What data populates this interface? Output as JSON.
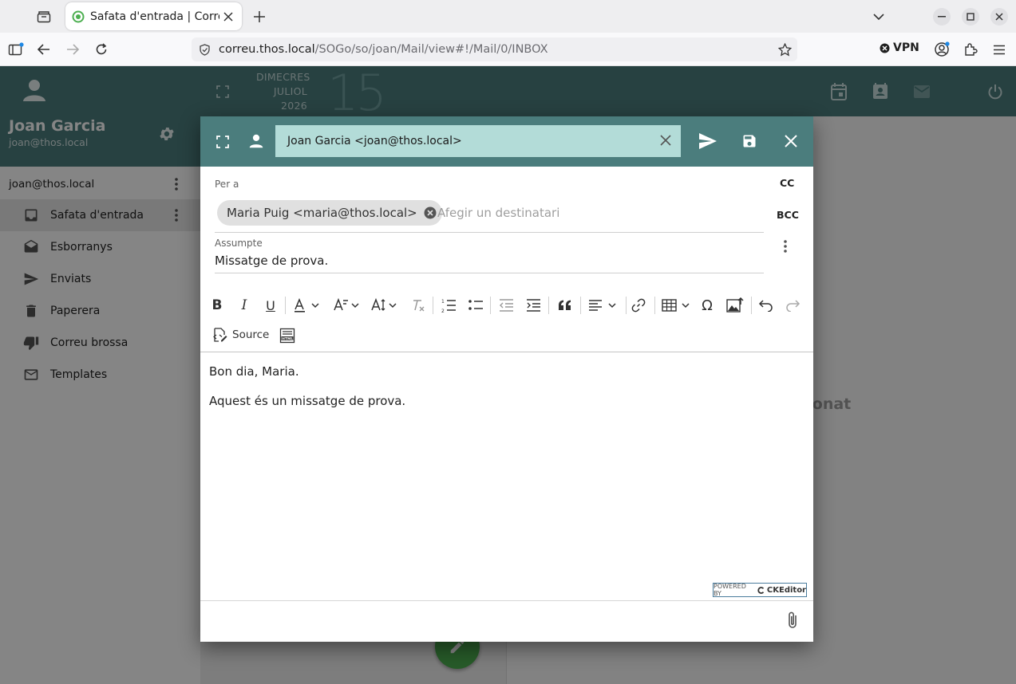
{
  "browser": {
    "tab_title": "Safata d'entrada | Correu",
    "url_host": "correu.thos.local",
    "url_path": "/SOGo/so/joan/Mail/view#!/Mail/0/INBOX",
    "vpn_label": "VPN"
  },
  "user": {
    "name": "Joan Garcia",
    "email": "joan@thos.local"
  },
  "account": "joan@thos.local",
  "folders": [
    {
      "label": "Safata d'entrada",
      "icon": "inbox-icon"
    },
    {
      "label": "Esborranys",
      "icon": "drafts-icon"
    },
    {
      "label": "Enviats",
      "icon": "send-icon"
    },
    {
      "label": "Paperera",
      "icon": "trash-icon"
    },
    {
      "label": "Correu brossa",
      "icon": "thumb-down-icon"
    },
    {
      "label": "Templates",
      "icon": "mail-icon"
    }
  ],
  "date": {
    "weekday": "DIMECRES",
    "month": "JULIOL",
    "year": "2026",
    "day": "15"
  },
  "background": {
    "no_message_text": "cionat"
  },
  "compose": {
    "from": "Joan Garcia <joan@thos.local>",
    "to_label": "Per a",
    "recipient": "Maria Puig <maria@thos.local>",
    "to_placeholder": "Afegir un destinatari",
    "cc_label": "CC",
    "bcc_label": "BCC",
    "subject_label": "Assumpte",
    "subject": "Missatge de prova.",
    "source_label": "Source",
    "body": [
      "Bon dia, Maria.",
      "Aquest és un missatge de prova."
    ],
    "powered_by": "POWERED BY",
    "ckeditor": "CKEditor"
  },
  "colors": {
    "accent": "#4b7d7d",
    "from_field": "#b3dcd8",
    "fab": "#4caf50"
  }
}
